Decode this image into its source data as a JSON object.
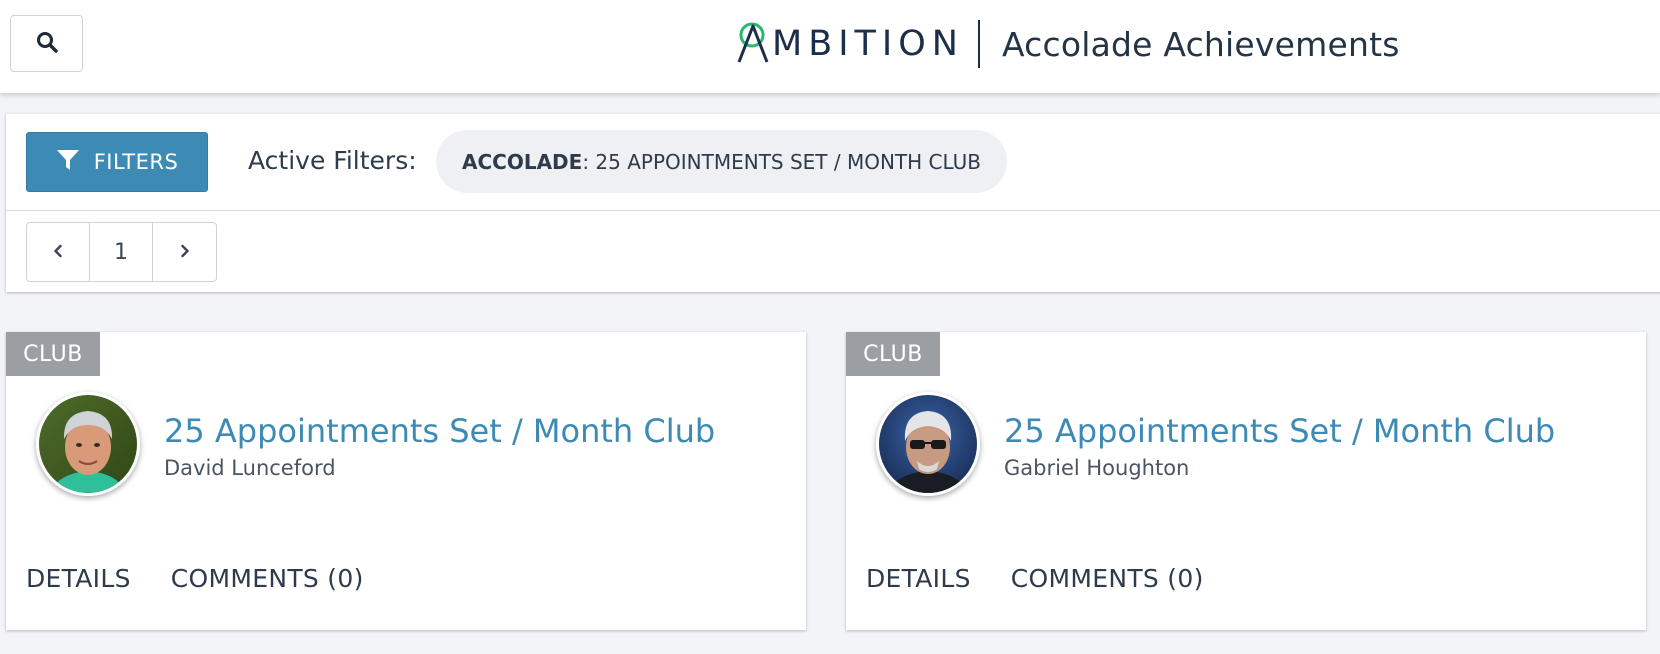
{
  "header": {
    "search_icon": "search-icon",
    "logo_text": "MBITION",
    "logo_accent_color": "#2bb673",
    "title": "Accolade Achievements"
  },
  "filters": {
    "button_label": "FILTERS",
    "button_icon": "filter-icon",
    "button_color": "#3d8bb4",
    "active_label": "Active Filters:",
    "chip_key": "ACCOLADE",
    "chip_value": ": 25 APPOINTMENTS SET / MONTH CLUB"
  },
  "pagination": {
    "prev_icon": "chevron-left-icon",
    "current_page": "1",
    "next_icon": "chevron-right-icon"
  },
  "cards": [
    {
      "badge": "CLUB",
      "title": "25 Appointments Set / Month Club",
      "person": "David Lunceford",
      "details_label": "DETAILS",
      "comments_label": "COMMENTS (0)"
    },
    {
      "badge": "CLUB",
      "title": "25 Appointments Set / Month Club",
      "person": "Gabriel Houghton",
      "details_label": "DETAILS",
      "comments_label": "COMMENTS (0)"
    }
  ]
}
